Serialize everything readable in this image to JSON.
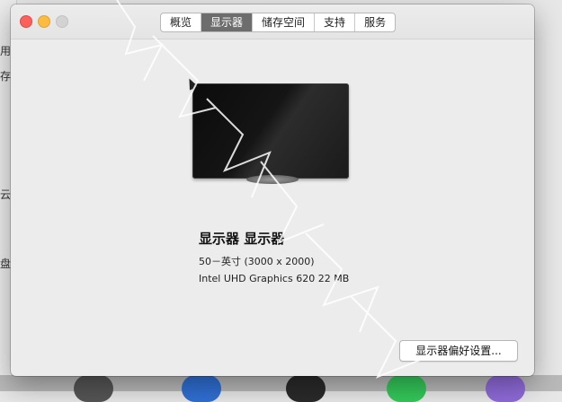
{
  "window": {
    "tabs": [
      {
        "label": "概览",
        "active": false
      },
      {
        "label": "显示器",
        "active": true
      },
      {
        "label": "储存空间",
        "active": false
      },
      {
        "label": "支持",
        "active": false
      },
      {
        "label": "服务",
        "active": false
      }
    ]
  },
  "display": {
    "name": "显示器 显示器",
    "resolution": "50－英寸 (3000 x 2000)",
    "graphics": "Intel UHD Graphics 620 22 MB"
  },
  "buttons": {
    "display_prefs": "显示器偏好设置..."
  },
  "background_window": {
    "labels": [
      "用",
      "存",
      "云",
      "盘"
    ]
  },
  "colors": {
    "close": "#fc605c",
    "minimize": "#fdbc40",
    "zoom_inactive": "#d3d3d3",
    "active_tab": "#6d6d6d"
  }
}
